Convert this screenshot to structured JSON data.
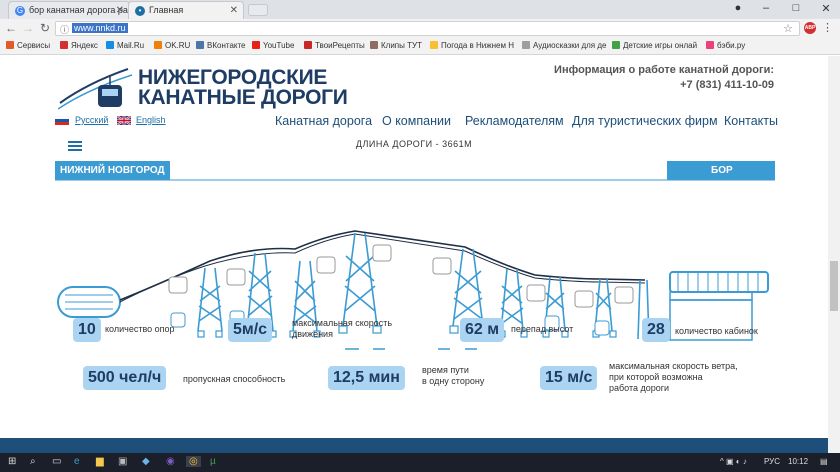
{
  "browser": {
    "tabs": [
      {
        "title": "бор канатная дорога ра",
        "favicon": "google-icon",
        "active": false
      },
      {
        "title": "Главная",
        "favicon": "site-icon",
        "active": true
      }
    ],
    "url": "www.nnkd.ru",
    "bookmarks": [
      "Сервисы",
      "Яндекс",
      "Mail.Ru",
      "OK.RU",
      "ВКонтакте",
      "YouTube",
      "ТвоиРецепты",
      "Клипы ТУТ",
      "Погода в Нижнем Н",
      "Аудиосказки для де",
      "Детские игры онлай",
      "бэби.ру"
    ]
  },
  "header": {
    "brand_line1": "НИЖЕГОРОДСКИЕ",
    "brand_line2": "КАНАТНЫЕ ДОРОГИ",
    "info_title": "Информация о работе канатной дороги:",
    "phone": "+7 (831) 411-10-09",
    "lang_ru": "Русский",
    "lang_en": "English"
  },
  "menu": [
    "Канатная дорога",
    "О компании",
    "Рекламодателям",
    "Для туристических фирм",
    "Контакты"
  ],
  "diagram": {
    "length_title": "ДЛИНА ДОРОГИ - 3661М",
    "left_station": "НИЖНИЙ НОВГОРОД",
    "right_station": "БОР",
    "color": "#3b9bd3"
  },
  "stats": [
    {
      "value": "10",
      "label": "количество опор"
    },
    {
      "value": "5м/с",
      "label1": "максимальная скорость",
      "label2": "движения"
    },
    {
      "value": "62 м",
      "label": "перепад высот"
    },
    {
      "value": "28",
      "label": "количество кабинок"
    },
    {
      "value": "500 чел/ч",
      "label": "пропускная способность"
    },
    {
      "value": "12,5 мин",
      "label1": "время пути",
      "label2": "в одну сторону"
    },
    {
      "value": "15 м/с",
      "label1": "максимальная скорость ветра,",
      "label2": "при которой возможна",
      "label3": "работа дороги"
    }
  ],
  "taskbar": {
    "lang": "РУС",
    "time": "10:12"
  }
}
